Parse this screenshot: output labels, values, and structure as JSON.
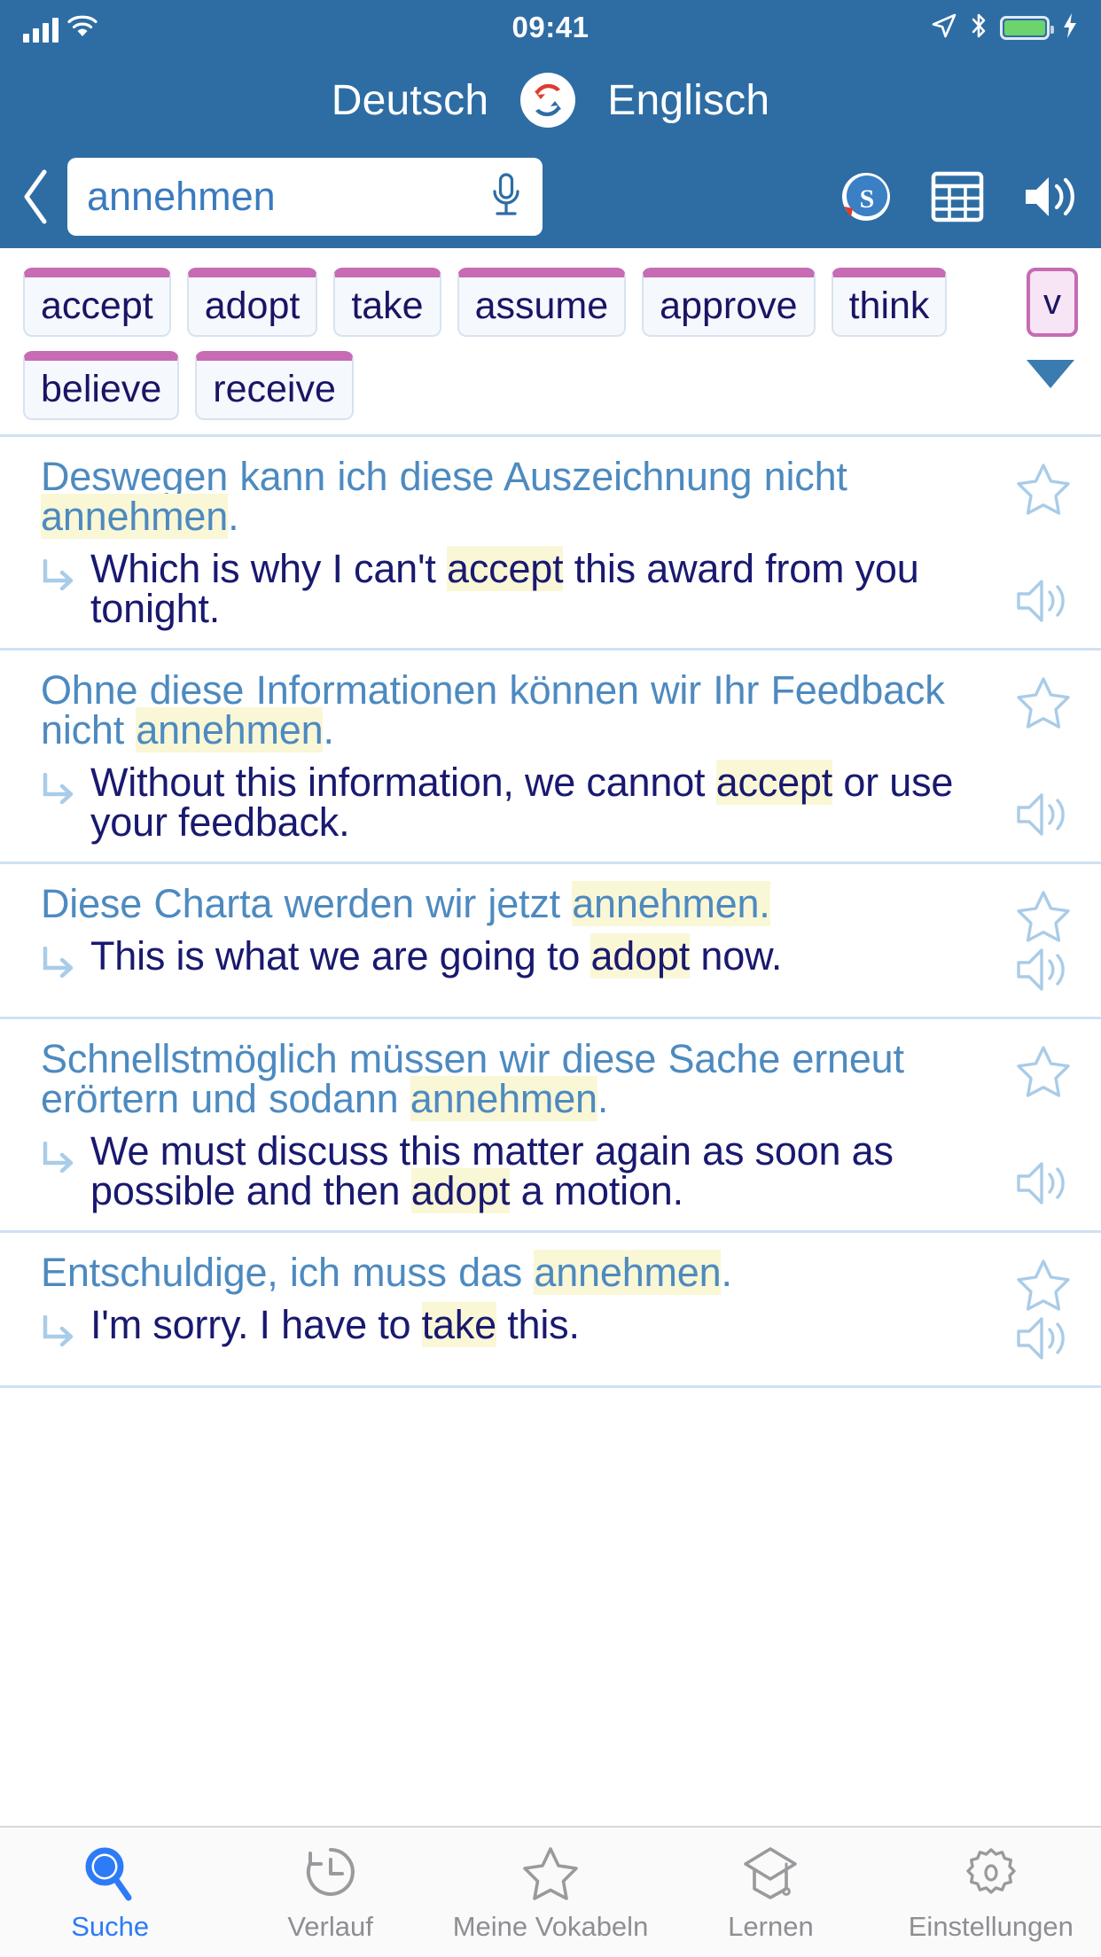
{
  "status_bar": {
    "time": "09:41",
    "icons": [
      "signal-bars-icon",
      "wifi-icon",
      "location-arrow-icon",
      "bluetooth-icon",
      "battery-icon",
      "charging-bolt-icon"
    ]
  },
  "header": {
    "source_language": "Deutsch",
    "target_language": "Englisch",
    "swap_icon": "swap-languages-icon",
    "back_icon": "chevron-left-icon",
    "brand_color": "#2E6DA4"
  },
  "search": {
    "value": "annehmen",
    "placeholder": "annehmen",
    "mic_icon": "microphone-icon",
    "tools": [
      {
        "name": "linguee-s-icon",
        "label": "S"
      },
      {
        "name": "conjugation-table-icon",
        "label": "Tabelle"
      },
      {
        "name": "speaker-icon",
        "label": "Aussprache"
      }
    ]
  },
  "translations": {
    "chips": [
      "accept",
      "adopt",
      "take",
      "assume",
      "approve",
      "think",
      "believe",
      "receive"
    ],
    "pos_badge": "v",
    "expand_icon": "triangle-down-icon",
    "chip_accent_color": "#C66BB4"
  },
  "results": [
    {
      "source_prefix": "Deswegen kann ich diese Auszeichnung nicht ",
      "source_highlight": "annehmen",
      "source_suffix": ".",
      "target_prefix": "Which is why I can't ",
      "target_highlight": "accept",
      "target_suffix": " this award from you tonight.",
      "star_icon": "star-outline-icon",
      "speaker_icon": "speaker-icon"
    },
    {
      "source_prefix": "Ohne diese Informationen können wir Ihr Feedback nicht ",
      "source_highlight": "annehmen",
      "source_suffix": ".",
      "target_prefix": "Without this information, we cannot ",
      "target_highlight": "accept",
      "target_suffix": " or use your feedback.",
      "star_icon": "star-outline-icon",
      "speaker_icon": "speaker-icon"
    },
    {
      "source_prefix": "Diese Charta werden wir jetzt ",
      "source_highlight": "annehmen.",
      "source_suffix": "",
      "target_prefix": "This is what we are going to ",
      "target_highlight": "adopt",
      "target_suffix": " now.",
      "star_icon": "star-outline-icon",
      "speaker_icon": "speaker-icon"
    },
    {
      "source_prefix": "Schnellstmöglich müssen wir diese Sache erneut erörtern und sodann ",
      "source_highlight": "annehmen",
      "source_suffix": ".",
      "target_prefix": "We must discuss this matter again as soon as possible and then ",
      "target_highlight": "adopt",
      "target_suffix": " a motion.",
      "star_icon": "star-outline-icon",
      "speaker_icon": "speaker-icon"
    },
    {
      "source_prefix": "Entschuldige, ich muss das ",
      "source_highlight": "annehmen",
      "source_suffix": ".",
      "target_prefix": "I'm sorry. I have to ",
      "target_highlight": "take",
      "target_suffix": " this.",
      "star_icon": "star-outline-icon",
      "speaker_icon": "speaker-icon"
    }
  ],
  "tabbar": {
    "active_color": "#2D7BF6",
    "items": [
      {
        "label": "Suche",
        "icon": "magnifier-icon",
        "active": true
      },
      {
        "label": "Verlauf",
        "icon": "history-clock-icon",
        "active": false
      },
      {
        "label": "Meine Vokabeln",
        "icon": "star-outline-icon",
        "active": false
      },
      {
        "label": "Lernen",
        "icon": "graduation-cap-icon",
        "active": false
      },
      {
        "label": "Einstellungen",
        "icon": "gear-icon",
        "active": false
      }
    ]
  }
}
